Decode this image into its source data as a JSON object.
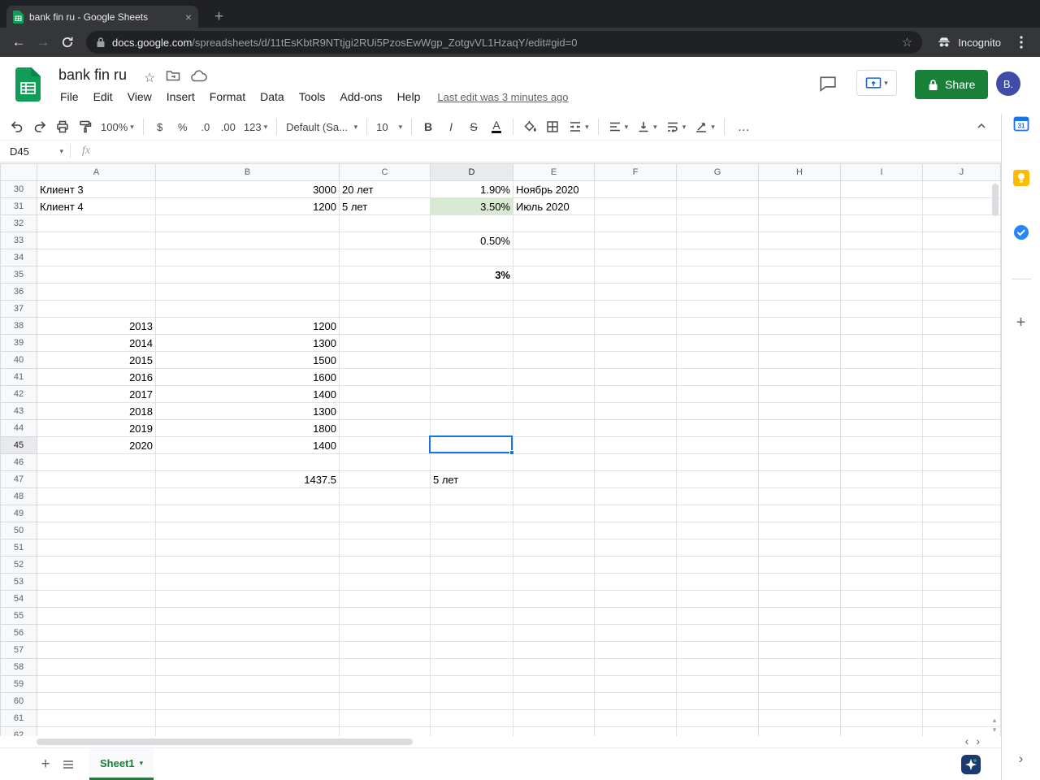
{
  "browser": {
    "tab_title": "bank fin ru - Google Sheets",
    "new_tab_label": "+",
    "url_domain": "docs.google.com",
    "url_path": "/spreadsheets/d/11tEsKbtR9NTtjgi2RUi5PzosEwWgp_ZotgvVL1HzaqY/edit#gid=0",
    "incognito_label": "Incognito"
  },
  "header": {
    "doc_title": "bank fin ru",
    "menus": [
      "File",
      "Edit",
      "View",
      "Insert",
      "Format",
      "Data",
      "Tools",
      "Add-ons",
      "Help"
    ],
    "last_edit": "Last edit was 3 minutes ago",
    "share_label": "Share",
    "avatar_label": "B."
  },
  "toolbar": {
    "zoom": "100%",
    "currency": "$",
    "percent": "%",
    "decimal_decrease": ".0",
    "decimal_increase": ".00",
    "more_formats": "123",
    "font_name": "Default (Sa...",
    "font_size": "10",
    "bold": "B",
    "italic": "I",
    "strikethrough": "S",
    "text_color": "A",
    "more": "…"
  },
  "formula_bar": {
    "name_box": "D45",
    "fx_label": "fx",
    "content": ""
  },
  "grid": {
    "columns": [
      "A",
      "B",
      "C",
      "D",
      "E",
      "F",
      "G",
      "H",
      "I",
      "J"
    ],
    "selection": {
      "row": 45,
      "col": "D"
    },
    "cell_styles": [
      {
        "row": 31,
        "col": "D",
        "bg": "#d9ead3"
      },
      {
        "row": 35,
        "col": "D",
        "bold": true
      }
    ],
    "rows": [
      {
        "n": 30,
        "cells": {
          "A": "Клиент 3",
          "B": "3000",
          "C": "20 лет",
          "D": "1.90%",
          "E": "Ноябрь 2020"
        }
      },
      {
        "n": 31,
        "cells": {
          "A": "Клиент 4",
          "B": "1200",
          "C": "5 лет",
          "D": "3.50%",
          "E": "Июль 2020"
        }
      },
      {
        "n": 32
      },
      {
        "n": 33,
        "cells": {
          "D": "0.50%"
        }
      },
      {
        "n": 34
      },
      {
        "n": 35,
        "cells": {
          "D": "3%"
        }
      },
      {
        "n": 36
      },
      {
        "n": 37
      },
      {
        "n": 38,
        "cells": {
          "A": "2013",
          "B": "1200"
        }
      },
      {
        "n": 39,
        "cells": {
          "A": "2014",
          "B": "1300"
        }
      },
      {
        "n": 40,
        "cells": {
          "A": "2015",
          "B": "1500"
        }
      },
      {
        "n": 41,
        "cells": {
          "A": "2016",
          "B": "1600"
        }
      },
      {
        "n": 42,
        "cells": {
          "A": "2017",
          "B": "1400"
        }
      },
      {
        "n": 43,
        "cells": {
          "A": "2018",
          "B": "1300"
        }
      },
      {
        "n": 44,
        "cells": {
          "A": "2019",
          "B": "1800"
        }
      },
      {
        "n": 45,
        "cells": {
          "A": "2020",
          "B": "1400"
        }
      },
      {
        "n": 46
      },
      {
        "n": 47,
        "cells": {
          "B": "1437.5",
          "D": "5 лет"
        }
      },
      {
        "n": 48
      },
      {
        "n": 49
      },
      {
        "n": 50
      },
      {
        "n": 51
      },
      {
        "n": 52
      },
      {
        "n": 53
      },
      {
        "n": 54
      },
      {
        "n": 55
      },
      {
        "n": 56
      },
      {
        "n": 57
      },
      {
        "n": 58
      },
      {
        "n": 59
      },
      {
        "n": 60
      },
      {
        "n": 61
      },
      {
        "n": 62
      }
    ]
  },
  "sheet_bar": {
    "add_sheet": "+",
    "sheet_name": "Sheet1"
  },
  "side_panel": {
    "calendar_label": "31"
  },
  "colors": {
    "brand_green": "#0f9d58",
    "share_green": "#188038",
    "selection_blue": "#1a73e8",
    "highlight_green": "#d9ead3",
    "avatar_bg": "#3f4da8"
  }
}
